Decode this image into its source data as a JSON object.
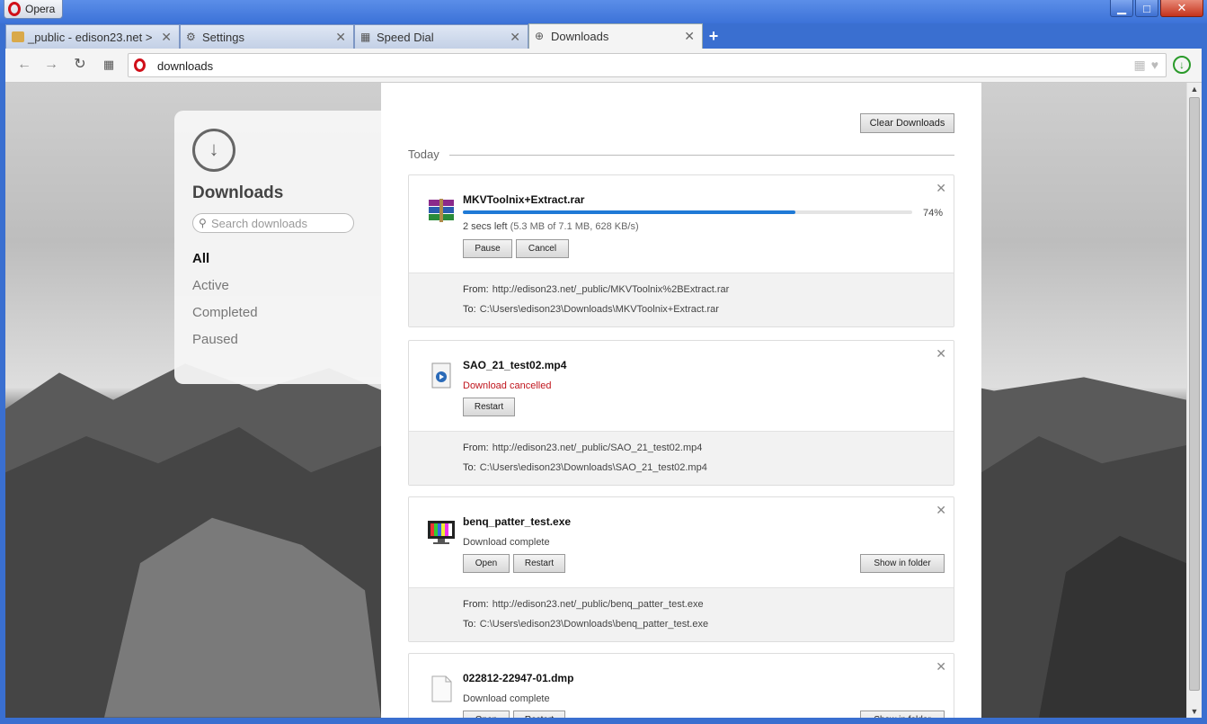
{
  "window": {
    "app_button": "Opera",
    "controls": {
      "minimize": "▁",
      "maximize": "□",
      "close": "✕"
    }
  },
  "tabs": [
    {
      "title": "_public - edison23.net >",
      "icon": "folder-icon",
      "active": false
    },
    {
      "title": "Settings",
      "icon": "gear-icon",
      "active": false
    },
    {
      "title": "Speed Dial",
      "icon": "grid-icon",
      "active": false
    },
    {
      "title": "Downloads",
      "icon": "download-icon",
      "active": true
    }
  ],
  "address_bar": {
    "value": "downloads"
  },
  "sidebar": {
    "title": "Downloads",
    "search_placeholder": "Search downloads",
    "filters": [
      "All",
      "Active",
      "Completed",
      "Paused"
    ],
    "active_filter": "All"
  },
  "main": {
    "clear_label": "Clear Downloads",
    "section_label": "Today",
    "from_label": "From:",
    "to_label": "To:"
  },
  "downloads": [
    {
      "name": "MKVToolnix+Extract.rar",
      "time_left": "2 secs left",
      "detail": "(5.3 MB of 7.1 MB, 628 KB/s)",
      "progress": 0.74,
      "percent_label": "74%",
      "buttons": [
        "Pause",
        "Cancel"
      ],
      "from": "http://edison23.net/_public/MKVToolnix%2BExtract.rar",
      "to": "C:\\Users\\edison23\\Downloads\\MKVToolnix+Extract.rar"
    },
    {
      "name": "SAO_21_test02.mp4",
      "status": "Download cancelled",
      "buttons": [
        "Restart"
      ],
      "from": "http://edison23.net/_public/SAO_21_test02.mp4",
      "to": "C:\\Users\\edison23\\Downloads\\SAO_21_test02.mp4"
    },
    {
      "name": "benq_patter_test.exe",
      "status": "Download complete",
      "buttons": [
        "Open",
        "Restart"
      ],
      "folder_button": "Show in folder",
      "from": "http://edison23.net/_public/benq_patter_test.exe",
      "to": "C:\\Users\\edison23\\Downloads\\benq_patter_test.exe"
    },
    {
      "name": "022812-22947-01.dmp",
      "status": "Download complete",
      "buttons": [
        "Open",
        "Restart"
      ],
      "folder_button": "Show in folder"
    }
  ],
  "colors": {
    "accent": "#1f7ad6",
    "cancel": "#c0151d",
    "opera_red": "#d0101a"
  }
}
